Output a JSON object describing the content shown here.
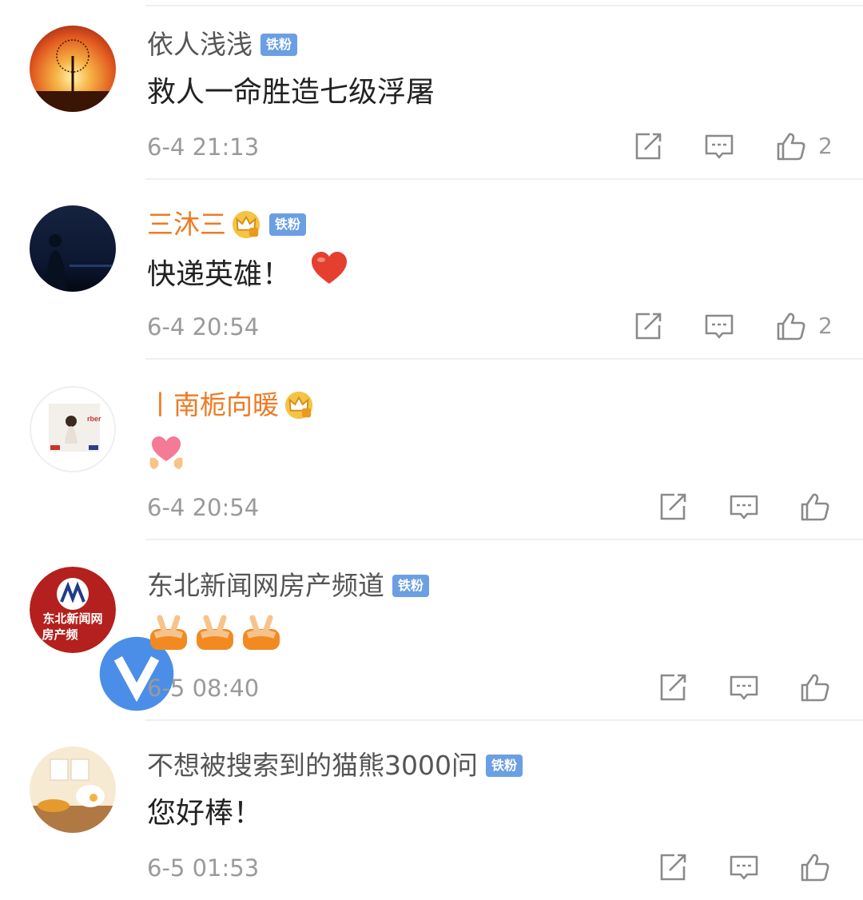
{
  "comments": [
    {
      "name": "依人浅浅",
      "badge": "铁粉",
      "text": "救人一命胜造七级浮屠",
      "time": "6-4 21:13",
      "likes": "2"
    },
    {
      "name": "三沐三",
      "badge": "铁粉",
      "text": "快递英雄！",
      "time": "6-4 20:54",
      "likes": "2"
    },
    {
      "name": "丨南栀向暖",
      "text": "",
      "time": "6-4 20:54"
    },
    {
      "name": "东北新闻网房产频道",
      "badge": "铁粉",
      "text": "",
      "time": "6-5 08:40"
    },
    {
      "name": "不想被搜索到的猫熊3000问",
      "badge": "铁粉",
      "text": "您好棒！",
      "time": "6-5 01:53"
    }
  ],
  "avatar_texts": {
    "news_line1": "东北新闻网",
    "news_line2": "房产频"
  },
  "colors": {
    "vip_name": "#ee7a23",
    "plain_name": "#555555",
    "badge_bg": "#6b9fe3",
    "icon_gray": "#8a8a8a"
  },
  "icons": [
    "repost-icon",
    "comment-icon",
    "like-icon",
    "crown-icon",
    "verified-icon",
    "heart-emoji",
    "love-emoji",
    "victory-emoji"
  ]
}
